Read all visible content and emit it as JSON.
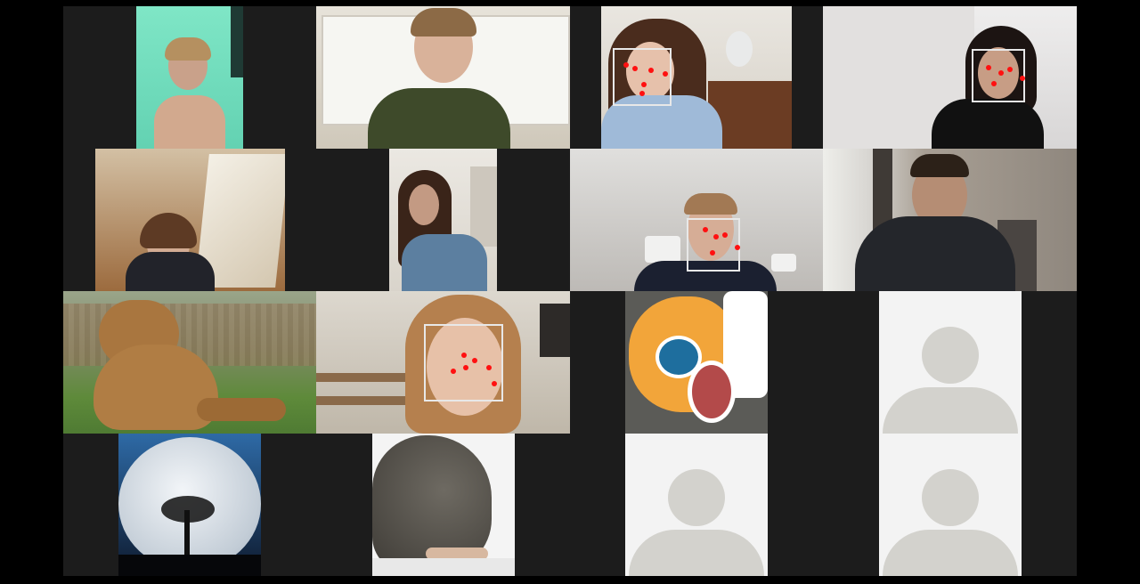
{
  "meeting": {
    "view": "gallery",
    "columns": 4,
    "rows": 4
  },
  "participants": [
    {
      "id": "p1",
      "video": "on"
    },
    {
      "id": "p2",
      "video": "on"
    },
    {
      "id": "p3",
      "video": "on",
      "face_tracking": true
    },
    {
      "id": "p4",
      "video": "on",
      "face_tracking": true
    },
    {
      "id": "p5",
      "video": "on"
    },
    {
      "id": "p6",
      "video": "on"
    },
    {
      "id": "p7",
      "video": "on",
      "face_tracking": true
    },
    {
      "id": "p8",
      "video": "on"
    },
    {
      "id": "p9",
      "video": "picture",
      "picture": "bear"
    },
    {
      "id": "p10",
      "video": "on",
      "face_tracking": true
    },
    {
      "id": "p11",
      "video": "picture",
      "picture": "clownfish-plush"
    },
    {
      "id": "p12",
      "video": "off"
    },
    {
      "id": "p13",
      "video": "picture",
      "picture": "full-moon"
    },
    {
      "id": "p14",
      "video": "picture",
      "picture": "seal-plush"
    },
    {
      "id": "p15",
      "video": "off"
    },
    {
      "id": "p16",
      "video": "off"
    }
  ],
  "icons": {
    "placeholder": "user-silhouette-icon"
  },
  "colors": {
    "background": "#000000",
    "tile_gap": "#1c1c1c",
    "face_tracker": "#e8e8e8",
    "landmark": "#ff1010",
    "placeholder_bg": "#f3f3f3",
    "placeholder_icon": "#d3d2cd"
  }
}
